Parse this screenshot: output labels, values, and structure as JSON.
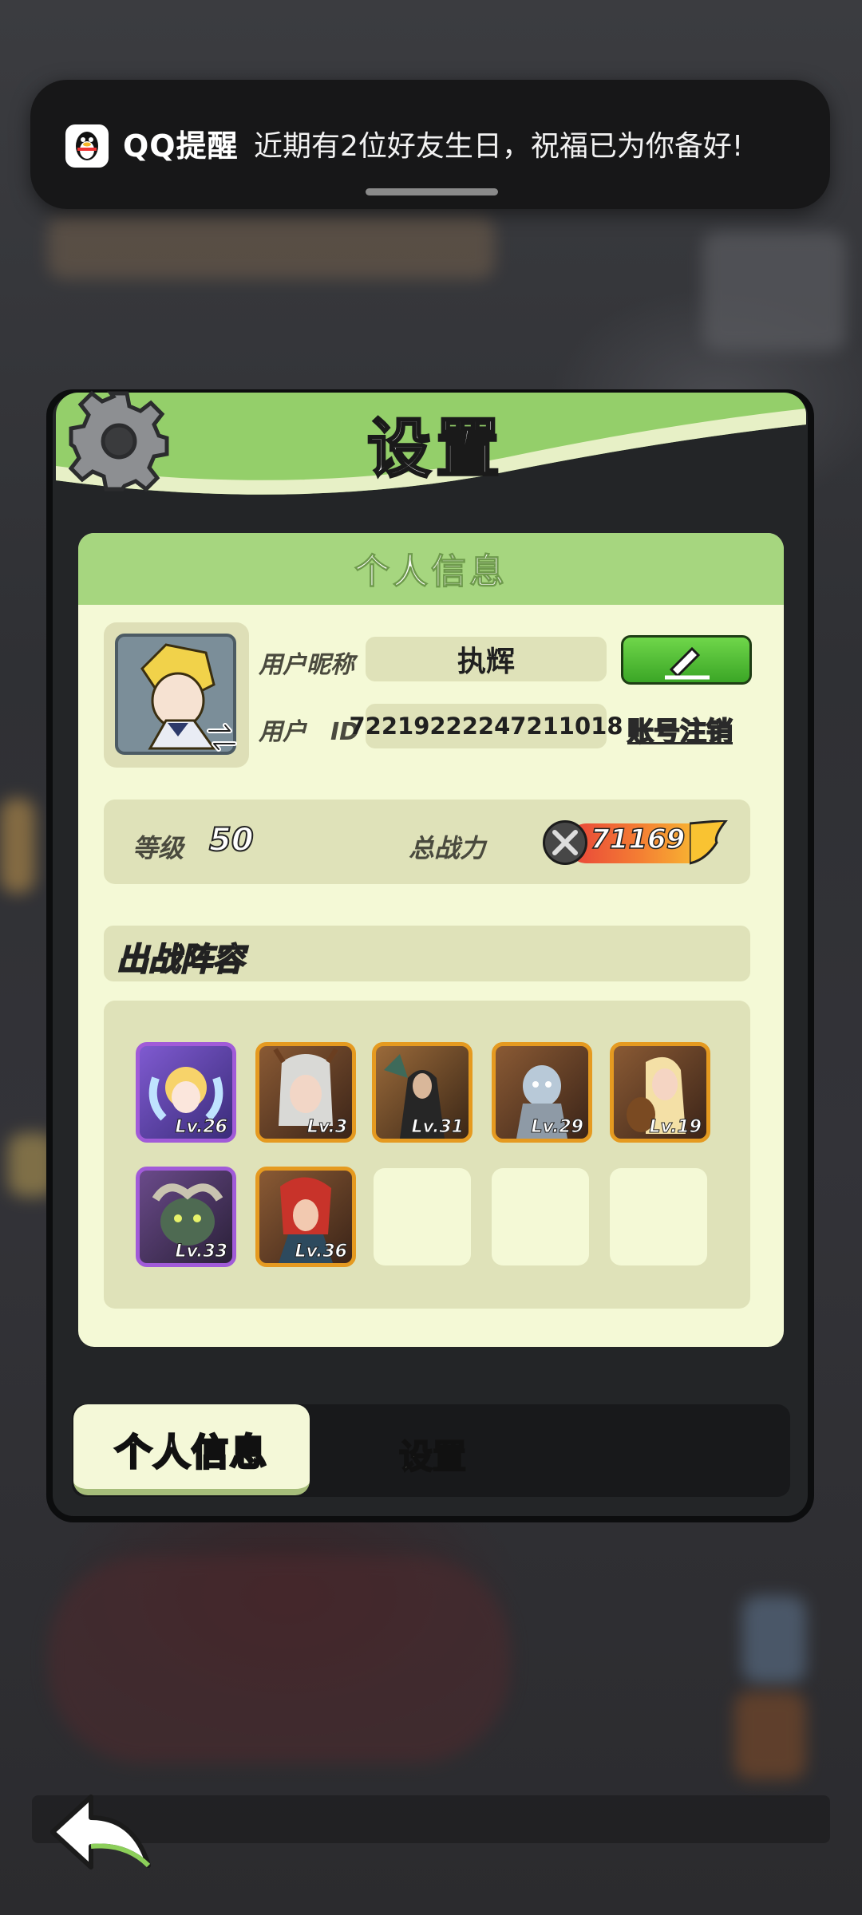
{
  "notification": {
    "app": "QQ提醒",
    "message": "近期有2位好友生日，祝福已为你备好!"
  },
  "panel": {
    "title": "设置"
  },
  "profile": {
    "section_title": "个人信息",
    "nickname_label": "用户昵称",
    "nickname": "执辉",
    "id_label": "用户　ID",
    "user_id": "72219222247211018",
    "cancel_account": "账号注销",
    "level_label": "等级",
    "level": "50",
    "power_label": "总战力",
    "power": "71169"
  },
  "lineup": {
    "title": "出战阵容",
    "heroes": [
      {
        "level": "Lv.26",
        "rarity": "purple"
      },
      {
        "level": "Lv.3",
        "rarity": "orange"
      },
      {
        "level": "Lv.31",
        "rarity": "orange"
      },
      {
        "level": "Lv.29",
        "rarity": "orange"
      },
      {
        "level": "Lv.19",
        "rarity": "orange"
      },
      {
        "level": "Lv.33",
        "rarity": "purple"
      },
      {
        "level": "Lv.36",
        "rarity": "orange"
      }
    ],
    "empty_slots": 3
  },
  "tabs": {
    "active": "个人信息",
    "other": "设置"
  },
  "icons": {
    "gear": "gear-icon",
    "edit": "pencil-icon",
    "back": "back-arrow-icon",
    "swap": "swap-icon",
    "power": "crossed-swords-icon"
  },
  "colors": {
    "header_green": "#94cf6a",
    "card_bg": "#f4f9d6",
    "field_bg": "#dfe2b9",
    "purple_frame": "#a15bd8",
    "orange_frame": "#e59a20",
    "edit_button": "#4fbd33"
  }
}
